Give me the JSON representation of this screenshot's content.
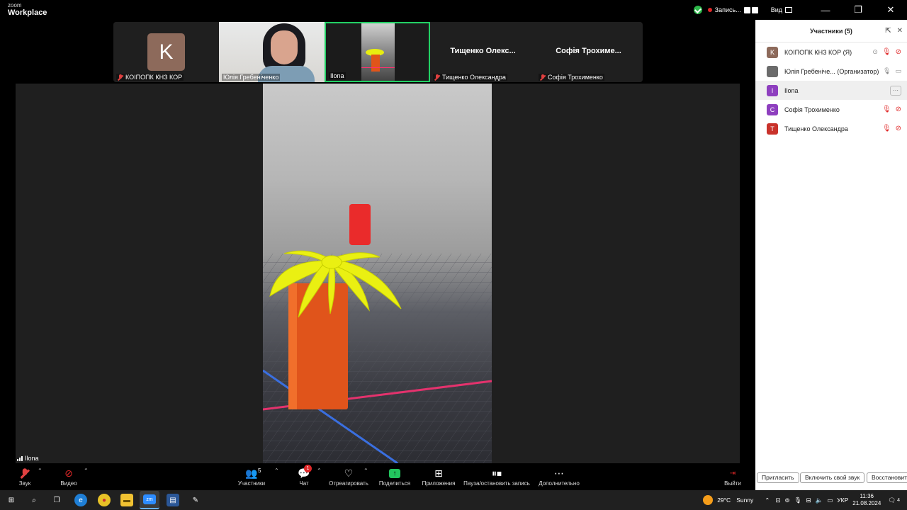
{
  "app": {
    "logo_top": "zoom",
    "logo_bottom": "Workplace"
  },
  "titlebar": {
    "recording_label": "Запись...",
    "view_label": "Вид",
    "minimize": "—",
    "restore": "❐",
    "close": "✕"
  },
  "strip": {
    "tiles": [
      {
        "name": "КОІПОПК КНЗ КОР",
        "avatar_letter": "K",
        "big_name": ""
      },
      {
        "name": "Юлія Гребеніченко",
        "avatar_letter": "",
        "big_name": ""
      },
      {
        "name": "Ilona",
        "avatar_letter": "",
        "big_name": ""
      },
      {
        "name": "Тищенко Олександра",
        "avatar_letter": "",
        "big_name": "Тищенко  Олекс..."
      },
      {
        "name": "Софія Трохименко",
        "avatar_letter": "",
        "big_name": "Софія  Трохиме..."
      }
    ]
  },
  "stage": {
    "speaker_name": "Ilona"
  },
  "toolbar": {
    "audio": "Звук",
    "video": "Видео",
    "participants": "Участники",
    "participants_count": "5",
    "chat": "Чат",
    "chat_badge": "1",
    "react": "Отреагировать",
    "share": "Поделиться",
    "apps": "Приложения",
    "pause_record": "Пауза/остановить запись",
    "more": "Дополнительно",
    "leave": "Выйти"
  },
  "panel": {
    "title": "Участники (5)",
    "participants": [
      {
        "letter": "K",
        "name": "КОІПОПК КНЗ КОР (Я)",
        "color": "#8d6a5b"
      },
      {
        "letter": "",
        "name": "Юлія Гребеніче...  (Организатор)",
        "color": "#6b6b6b"
      },
      {
        "letter": "I",
        "name": "Ilona",
        "color": "#8e3fbf"
      },
      {
        "letter": "C",
        "name": "Софія Трохименко",
        "color": "#8e3fbf"
      },
      {
        "letter": "T",
        "name": "Тищенко Олександра",
        "color": "#c9322b"
      }
    ],
    "buttons": {
      "invite": "Пригласить",
      "unmute": "Включить свой звук",
      "restore": "Восстановит"
    }
  },
  "taskbar": {
    "temperature": "29°C",
    "weather": "Sunny",
    "lang": "УКР",
    "time": "11:36",
    "date": "21.08.2024",
    "notif_count": "4"
  }
}
